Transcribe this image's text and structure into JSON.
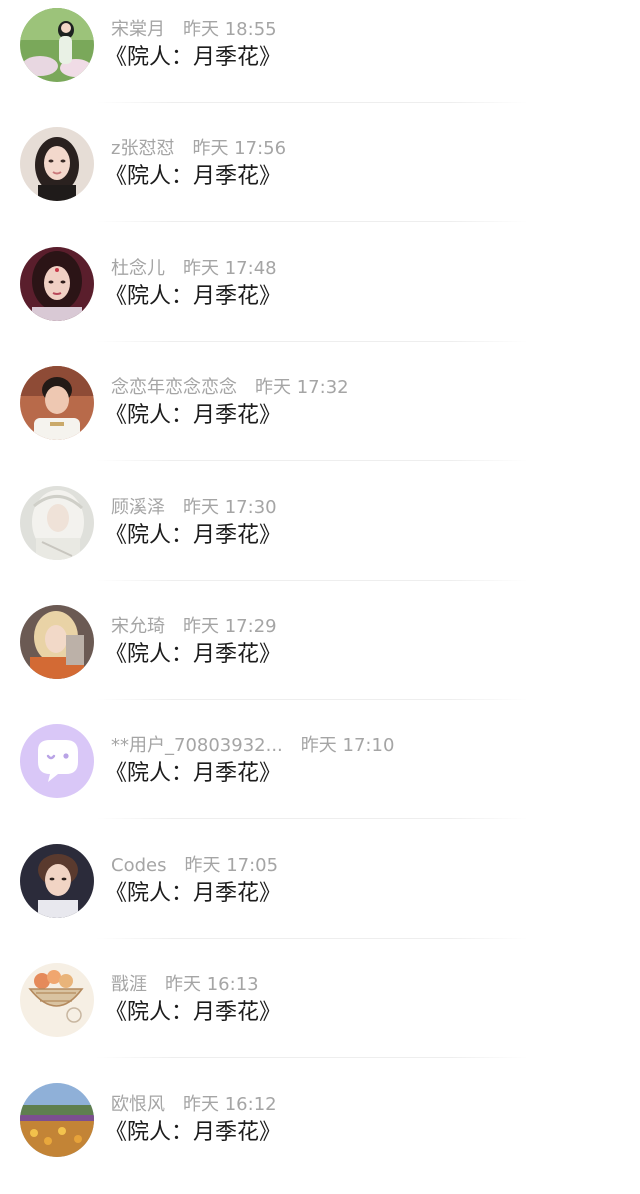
{
  "comments": [
    {
      "name": "宋棠月",
      "time": "昨天 18:55",
      "message": "《院人：月季花》",
      "avatar": "avatar-girl-garden"
    },
    {
      "name": "z张怼怼",
      "time": "昨天 17:56",
      "message": "《院人：月季花》",
      "avatar": "avatar-girl-portrait"
    },
    {
      "name": "杜念儿",
      "time": "昨天 17:48",
      "message": "《院人：月季花》",
      "avatar": "avatar-costume-woman"
    },
    {
      "name": "念恋年恋念恋念",
      "time": "昨天 17:32",
      "message": "《院人：月季花》",
      "avatar": "avatar-boy-photo"
    },
    {
      "name": "顾溪泽",
      "time": "昨天 17:30",
      "message": "《院人：月季花》",
      "avatar": "avatar-white-hair-art"
    },
    {
      "name": "宋允琦",
      "time": "昨天 17:29",
      "message": "《院人：月季花》",
      "avatar": "avatar-blonde-character"
    },
    {
      "name": "**用户_70803932...",
      "time": "昨天 17:10",
      "message": "《院人：月季花》",
      "avatar": "avatar-default-chat"
    },
    {
      "name": "Codes",
      "time": "昨天 17:05",
      "message": "《院人：月季花》",
      "avatar": "avatar-young-man"
    },
    {
      "name": "戬涯",
      "time": "昨天 16:13",
      "message": "《院人：月季花》",
      "avatar": "avatar-basket-drawing"
    },
    {
      "name": "欧恨风",
      "time": "昨天 16:12",
      "message": "《院人：月季花》",
      "avatar": "avatar-flower-field"
    }
  ],
  "colors": {
    "name_time_text": "#a5a5a5",
    "message_text": "#1c1c1c",
    "default_avatar_bg": "#d9c7f7",
    "divider": "#eeeeee"
  }
}
